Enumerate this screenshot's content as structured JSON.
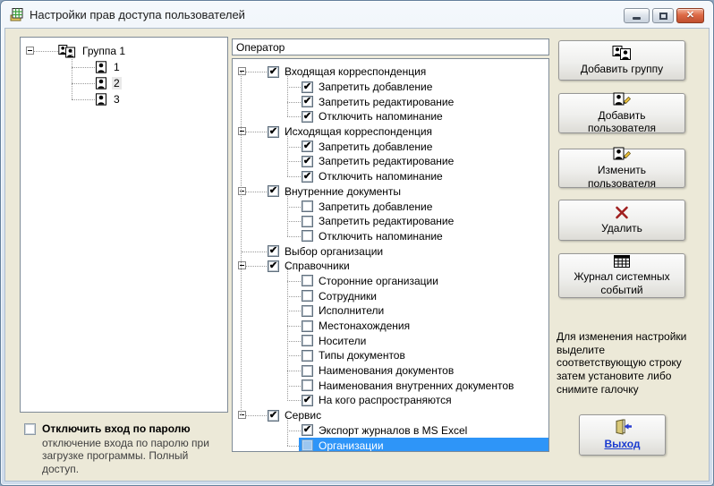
{
  "window": {
    "title": "Настройки прав доступа пользователей"
  },
  "left_tree": {
    "root_label": "Группа 1",
    "children": [
      {
        "label": "1",
        "highlighted": false
      },
      {
        "label": "2",
        "highlighted": true
      },
      {
        "label": "3",
        "highlighted": false
      }
    ]
  },
  "operator": {
    "value": "Оператор"
  },
  "permissions_tree": {
    "rows": [
      {
        "label": "Входящая корреспонденция",
        "level": 0,
        "expander": true,
        "checked": true,
        "selected": false
      },
      {
        "label": "Запретить добавление",
        "level": 1,
        "checked": true,
        "selected": false
      },
      {
        "label": "Запретить редактирование",
        "level": 1,
        "checked": true,
        "selected": false
      },
      {
        "label": "Отключить напоминание",
        "level": 1,
        "checked": true,
        "selected": false
      },
      {
        "label": "Исходящая корреспонденция",
        "level": 0,
        "expander": true,
        "checked": true,
        "selected": false
      },
      {
        "label": "Запретить добавление",
        "level": 1,
        "checked": true,
        "selected": false
      },
      {
        "label": "Запретить редактирование",
        "level": 1,
        "checked": true,
        "selected": false
      },
      {
        "label": "Отключить напоминание",
        "level": 1,
        "checked": true,
        "selected": false
      },
      {
        "label": "Внутренние документы",
        "level": 0,
        "expander": true,
        "checked": true,
        "selected": false
      },
      {
        "label": "Запретить добавление",
        "level": 1,
        "checked": false,
        "selected": false
      },
      {
        "label": "Запретить редактирование",
        "level": 1,
        "checked": false,
        "selected": false
      },
      {
        "label": "Отключить напоминание",
        "level": 1,
        "checked": false,
        "selected": false
      },
      {
        "label": "Выбор организации",
        "level": 0,
        "expander": false,
        "checked": true,
        "selected": false
      },
      {
        "label": "Справочники",
        "level": 0,
        "expander": true,
        "checked": true,
        "selected": false
      },
      {
        "label": "Сторонние организации",
        "level": 1,
        "checked": false,
        "selected": false
      },
      {
        "label": "Сотрудники",
        "level": 1,
        "checked": false,
        "selected": false
      },
      {
        "label": "Исполнители",
        "level": 1,
        "checked": false,
        "selected": false
      },
      {
        "label": "Местонахождения",
        "level": 1,
        "checked": false,
        "selected": false
      },
      {
        "label": "Носители",
        "level": 1,
        "checked": false,
        "selected": false
      },
      {
        "label": "Типы документов",
        "level": 1,
        "checked": false,
        "selected": false
      },
      {
        "label": "Наименования документов",
        "level": 1,
        "checked": false,
        "selected": false
      },
      {
        "label": "Наименования внутренних документов",
        "level": 1,
        "checked": false,
        "selected": false
      },
      {
        "label": "На кого распространяются",
        "level": 1,
        "checked": true,
        "selected": false
      },
      {
        "label": "Сервис",
        "level": 0,
        "expander": true,
        "checked": true,
        "selected": false
      },
      {
        "label": "Экспорт журналов в MS Excel",
        "level": 1,
        "checked": true,
        "selected": false
      },
      {
        "label": "Организации",
        "level": 1,
        "checked": false,
        "selected": true
      }
    ]
  },
  "password_option": {
    "label": "Отключить вход по паролю",
    "description": "отключение входа по паролю при загрузке программы. Полный доступ.",
    "checked": false
  },
  "buttons": {
    "add_group": "Добавить группу",
    "add_user": "Добавить пользователя",
    "edit_user": "Изменить пользователя",
    "delete": "Удалить",
    "journal": "Журнал системных событий",
    "exit": "Выход"
  },
  "hint": "Для изменения настройки выделите соответствующую строку затем установите либо снимите галочку",
  "colors": {
    "selection": "#2e95f8",
    "client_bg": "#ece9d8",
    "delete_x": "#a01f1f",
    "exit_link": "#1a3bd1"
  }
}
